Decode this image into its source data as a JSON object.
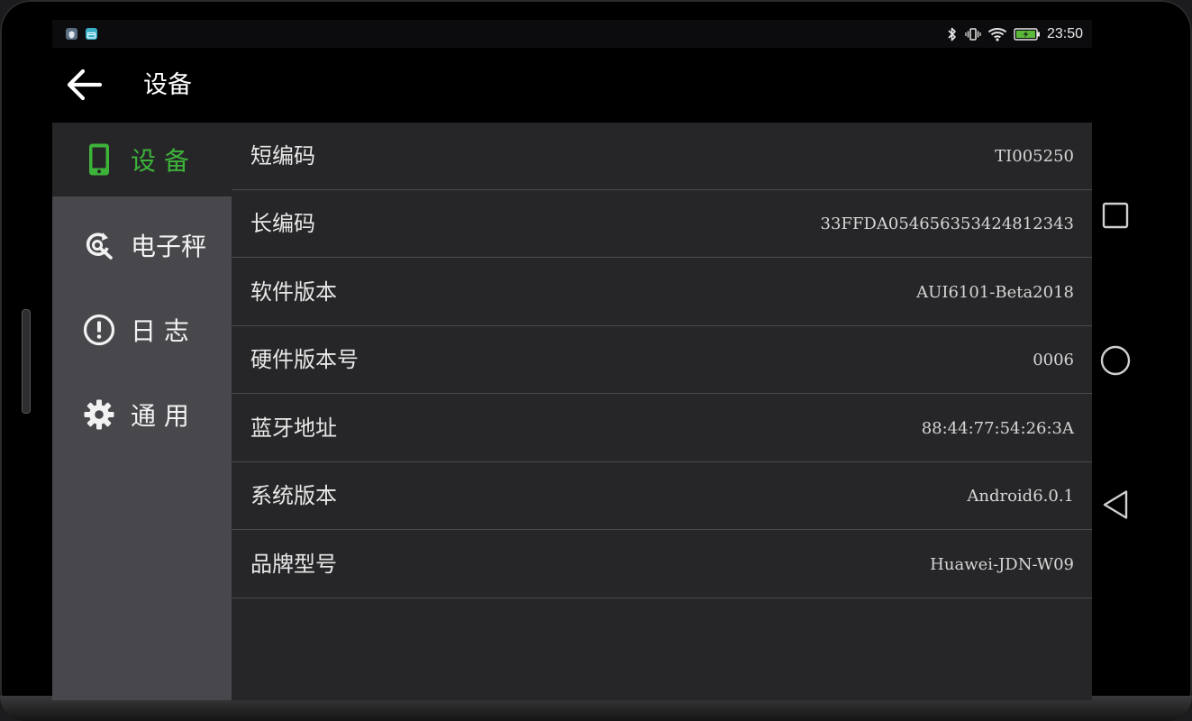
{
  "status_bar": {
    "time": "23:50",
    "icons": [
      "shield-notification-icon",
      "store-notification-icon",
      "bluetooth-icon",
      "vibrate-icon",
      "wifi-icon",
      "battery-charging-icon"
    ]
  },
  "app_bar": {
    "title": "设备",
    "back_icon": "arrow-left-icon"
  },
  "sidebar": {
    "items": [
      {
        "label": "设 备",
        "icon": "phone-icon",
        "active": true
      },
      {
        "label": "电子秤",
        "icon": "refresh-search-icon",
        "active": false
      },
      {
        "label": "日 志",
        "icon": "alert-circle-icon",
        "active": false
      },
      {
        "label": "通 用",
        "icon": "gear-icon",
        "active": false
      }
    ]
  },
  "details": {
    "rows": [
      {
        "label": "短编码",
        "value": "TI005250"
      },
      {
        "label": "长编码",
        "value": "33FFDA054656353424812343"
      },
      {
        "label": "软件版本",
        "value": "AUI6101-Beta2018"
      },
      {
        "label": "硬件版本号",
        "value": "0006"
      },
      {
        "label": "蓝牙地址",
        "value": "88:44:77:54:26:3A"
      },
      {
        "label": "系统版本",
        "value": "Android6.0.1"
      },
      {
        "label": "品牌型号",
        "value": "Huawei-JDN-W09"
      }
    ]
  },
  "colors": {
    "accent": "#3db33a",
    "sidebar": "#48484c",
    "content": "#262628"
  },
  "system_nav": [
    "recents-square-icon",
    "home-circle-icon",
    "back-triangle-icon"
  ]
}
